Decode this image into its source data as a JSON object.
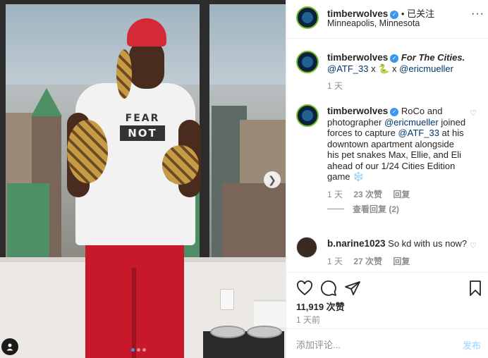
{
  "post": {
    "username": "timberwolves",
    "follow_label": "• 已关注",
    "location": "Minneapolis, Minnesota",
    "more": "···"
  },
  "photo": {
    "shirt_line1": "FEAR",
    "shirt_line2": "NOT",
    "next_icon": "chevron-right-icon",
    "user_tag_icon": "user-tag-icon",
    "pagination_total": 3,
    "pagination_active": 1
  },
  "comments": [
    {
      "username": "timberwolves",
      "verified": true,
      "text_italic": "For The Cities.",
      "mention1": "@ATF_33",
      "sep1": " x ",
      "emoji": "🐍",
      "sep2": " x ",
      "mention2": "@ericmueller",
      "time": "1 天"
    },
    {
      "username": "timberwolves",
      "verified": true,
      "text_a": " RoCo and photographer ",
      "mention1": "@ericmueller",
      "text_b": " joined forces to capture ",
      "mention2": "@ATF_33",
      "text_c": " at his downtown apartment alongside his pet snakes Max, Ellie, and Eli ahead of our 1/24 Cities Edition game ",
      "emoji": "❄️",
      "time": "1 天",
      "likes": "23 次赞",
      "reply": "回复",
      "view_replies": "查看回复 (2)"
    },
    {
      "username": "b.narine1023",
      "text": " So kd with us now?",
      "time": "1 天",
      "likes": "27 次赞",
      "reply": "回复"
    }
  ],
  "actions": {
    "like_count": "11,919 次赞",
    "posted": "1 天前"
  },
  "composer": {
    "placeholder": "添加评论...",
    "post_label": "发布"
  },
  "colors": {
    "accent_blue": "#3897f0",
    "mention_blue": "#00376b",
    "muted_gray": "#8e8e8e",
    "post_disabled": "#b2dffc"
  }
}
